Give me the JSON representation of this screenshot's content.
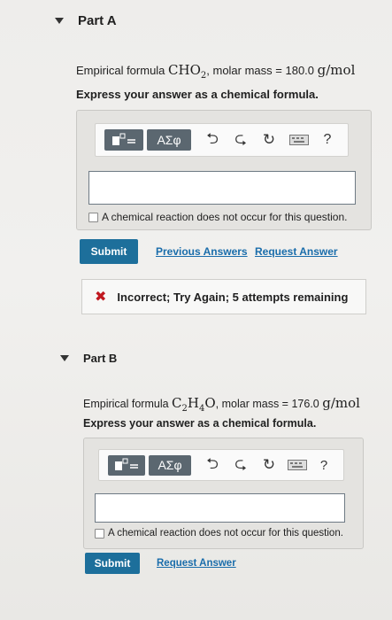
{
  "partA": {
    "title": "Part A",
    "problem_prefix": "Empirical formula ",
    "formula_main": "CHO",
    "formula_sub": "2",
    "problem_suffix": ", molar mass = ",
    "molar_mass_value": "180.0",
    "molar_mass_unit": "g/mol",
    "instruction": "Express your answer as a chemical formula.",
    "toolbar": {
      "greek_label": "ΑΣφ",
      "help_label": "?"
    },
    "input_value": "",
    "no_reaction_label": "A chemical reaction does not occur for this question.",
    "submit_label": "Submit",
    "previous_answers_label": "Previous Answers",
    "request_answer_label": "Request Answer",
    "feedback": "Incorrect; Try Again; 5 attempts remaining"
  },
  "partB": {
    "title": "Part B",
    "problem_prefix": "Empirical formula ",
    "formula_c": "C",
    "formula_c_sub": "2",
    "formula_h": "H",
    "formula_h_sub": "4",
    "formula_o": "O",
    "problem_suffix": ", molar mass = ",
    "molar_mass_value": "176.0",
    "molar_mass_unit": "g/mol",
    "instruction": "Express your answer as a chemical formula.",
    "toolbar": {
      "greek_label": "ΑΣφ",
      "help_label": "?"
    },
    "input_value": "",
    "no_reaction_label": "A chemical reaction does not occur for this question.",
    "submit_label": "Submit",
    "request_answer_label": "Request Answer"
  },
  "colors": {
    "submit": "#1d6f9b",
    "link": "#1a6dab",
    "error": "#c0181f",
    "toolbar_button": "#5b6770"
  }
}
